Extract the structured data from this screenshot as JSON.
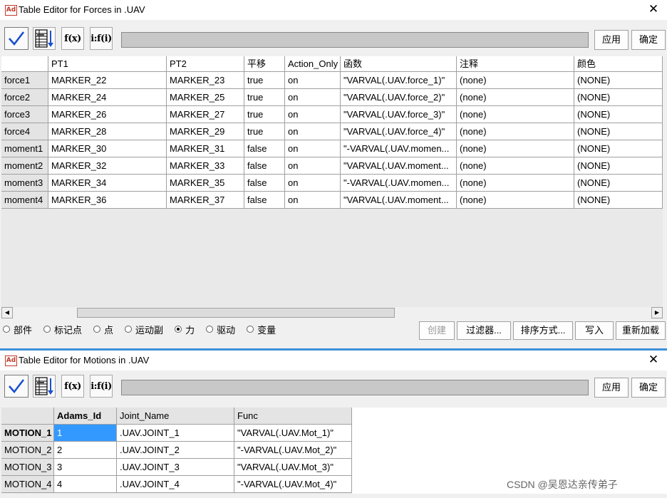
{
  "forces_window": {
    "title": "Table Editor for Forces in .UAV",
    "app_icon_text": "Ad",
    "close_icon": "close-icon",
    "toolbar": {
      "check_icon": "checkmark-icon",
      "sort_icon": "sort-table-icon",
      "fx_label": "f(x)",
      "ifx_label": "i:f(i)",
      "formula_value": "",
      "apply_label": "应用",
      "ok_label": "确定"
    },
    "table": {
      "columns": [
        "PT1",
        "PT2",
        "平移",
        "Action_Only",
        "函数",
        "注释",
        "颜色"
      ],
      "rows": [
        {
          "name": "force1",
          "cells": [
            "MARKER_22",
            "MARKER_23",
            "true",
            "on",
            "\"VARVAL(.UAV.force_1)\"",
            "(none)",
            "(NONE)"
          ]
        },
        {
          "name": "force2",
          "cells": [
            "MARKER_24",
            "MARKER_25",
            "true",
            "on",
            "\"VARVAL(.UAV.force_2)\"",
            "(none)",
            "(NONE)"
          ]
        },
        {
          "name": "force3",
          "cells": [
            "MARKER_26",
            "MARKER_27",
            "true",
            "on",
            "\"VARVAL(.UAV.force_3)\"",
            "(none)",
            "(NONE)"
          ]
        },
        {
          "name": "force4",
          "cells": [
            "MARKER_28",
            "MARKER_29",
            "true",
            "on",
            "\"VARVAL(.UAV.force_4)\"",
            "(none)",
            "(NONE)"
          ]
        },
        {
          "name": "moment1",
          "cells": [
            "MARKER_30",
            "MARKER_31",
            "false",
            "on",
            "\"-VARVAL(.UAV.momen...",
            "(none)",
            "(NONE)"
          ]
        },
        {
          "name": "moment2",
          "cells": [
            "MARKER_32",
            "MARKER_33",
            "false",
            "on",
            "\"VARVAL(.UAV.moment...",
            "(none)",
            "(NONE)"
          ]
        },
        {
          "name": "moment3",
          "cells": [
            "MARKER_34",
            "MARKER_35",
            "false",
            "on",
            "\"-VARVAL(.UAV.momen...",
            "(none)",
            "(NONE)"
          ]
        },
        {
          "name": "moment4",
          "cells": [
            "MARKER_36",
            "MARKER_37",
            "false",
            "on",
            "\"VARVAL(.UAV.moment...",
            "(none)",
            "(NONE)"
          ]
        }
      ]
    },
    "scroll_left_icon": "arrow-left-icon",
    "scroll_right_icon": "arrow-right-icon",
    "filter_radios": [
      {
        "label": "部件",
        "selected": false
      },
      {
        "label": "标记点",
        "selected": false
      },
      {
        "label": "点",
        "selected": false
      },
      {
        "label": "运动副",
        "selected": false
      },
      {
        "label": "力",
        "selected": true
      },
      {
        "label": "驱动",
        "selected": false
      },
      {
        "label": "变量",
        "selected": false
      }
    ],
    "bottom_buttons": {
      "create": "创建",
      "filter": "过滤器...",
      "sort": "排序方式...",
      "write": "写入",
      "reload": "重新加载"
    }
  },
  "motions_window": {
    "title": "Table Editor for Motions in .UAV",
    "app_icon_text": "Ad",
    "close_icon": "close-icon",
    "toolbar": {
      "check_icon": "checkmark-icon",
      "sort_icon": "sort-table-icon",
      "fx_label": "f(x)",
      "ifx_label": "i:f(i)",
      "formula_value": "",
      "apply_label": "应用",
      "ok_label": "确定"
    },
    "table": {
      "columns": [
        "Adams_Id",
        "Joint_Name",
        "Func"
      ],
      "rows": [
        {
          "name": "MOTION_1",
          "cells": [
            "1",
            ".UAV.JOINT_1",
            "\"VARVAL(.UAV.Mot_1)\""
          ]
        },
        {
          "name": "MOTION_2",
          "cells": [
            "2",
            ".UAV.JOINT_2",
            "\"-VARVAL(.UAV.Mot_2)\""
          ]
        },
        {
          "name": "MOTION_3",
          "cells": [
            "3",
            ".UAV.JOINT_3",
            "\"VARVAL(.UAV.Mot_3)\""
          ]
        },
        {
          "name": "MOTION_4",
          "cells": [
            "4",
            ".UAV.JOINT_4",
            "\"-VARVAL(.UAV.Mot_4)\""
          ]
        }
      ]
    }
  },
  "watermark": "CSDN @吴恩达亲传弟子",
  "colors": {
    "selection": "#3399ff",
    "window_accent": "#3c8fd8",
    "checkmark": "#1a4fd0",
    "app_icon": "#c0392b"
  }
}
